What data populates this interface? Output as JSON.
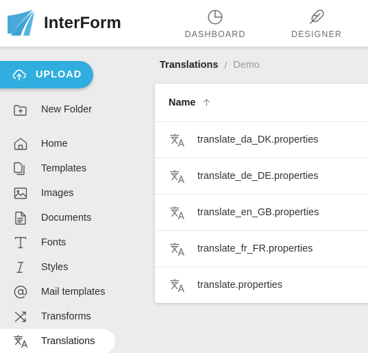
{
  "header": {
    "brand_name": "InterForm",
    "logo_icon": "interform-logo",
    "tabs": [
      {
        "label": "DASHBOARD",
        "icon": "pie-chart-icon"
      },
      {
        "label": "DESIGNER",
        "icon": "feather-icon"
      }
    ]
  },
  "sidebar": {
    "upload": {
      "label": "UPLOAD",
      "icon": "cloud-upload-icon",
      "color": "#31ADE0"
    },
    "items": [
      {
        "label": "New Folder",
        "icon": "folder-plus-icon",
        "selected": false
      },
      {
        "label": "Home",
        "icon": "home-icon",
        "selected": false
      },
      {
        "label": "Templates",
        "icon": "copy-pages-icon",
        "selected": false
      },
      {
        "label": "Images",
        "icon": "image-icon",
        "selected": false
      },
      {
        "label": "Documents",
        "icon": "document-icon",
        "selected": false
      },
      {
        "label": "Fonts",
        "icon": "font-t-icon",
        "selected": false
      },
      {
        "label": "Styles",
        "icon": "italic-i-icon",
        "selected": false
      },
      {
        "label": "Mail templates",
        "icon": "at-sign-icon",
        "selected": false
      },
      {
        "label": "Transforms",
        "icon": "shuffle-icon",
        "selected": false
      },
      {
        "label": "Translations",
        "icon": "translate-icon",
        "selected": true
      }
    ]
  },
  "main": {
    "breadcrumb": {
      "root": "Translations",
      "separator": "/",
      "current": "Demo"
    },
    "table": {
      "column_header": "Name",
      "sort_direction": "ascending",
      "sort_icon": "arrow-up-icon",
      "rows": [
        {
          "name": "translate_da_DK.properties",
          "icon": "translate-icon"
        },
        {
          "name": "translate_de_DE.properties",
          "icon": "translate-icon"
        },
        {
          "name": "translate_en_GB.properties",
          "icon": "translate-icon"
        },
        {
          "name": "translate_fr_FR.properties",
          "icon": "translate-icon"
        },
        {
          "name": "translate.properties",
          "icon": "translate-icon"
        }
      ]
    }
  },
  "theme": {
    "accent": "#31ADE0",
    "background": "#ececec",
    "panel": "#ffffff"
  }
}
